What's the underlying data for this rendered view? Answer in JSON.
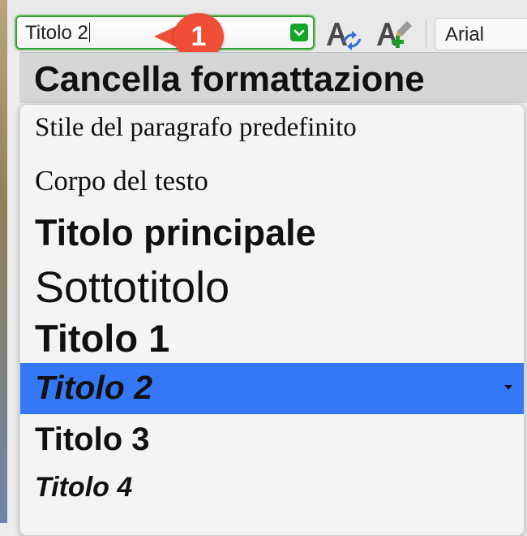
{
  "toolbar": {
    "paragraph_style_value": "Titolo 2",
    "font_name_value": "Arial",
    "combo_arrow_icon": "chevron-down-icon",
    "update_style_icon": "update-style-icon",
    "new_style_icon": "new-style-icon",
    "accent_green": "#34a233"
  },
  "callout": {
    "number": "1",
    "color": "#f04e36"
  },
  "dropdown": {
    "clear_formatting_label": "Cancella formattazione",
    "items": [
      {
        "label": "Stile del paragrafo predefinito",
        "selected": false
      },
      {
        "label": "Corpo del testo",
        "selected": false
      },
      {
        "label": "Titolo principale",
        "selected": false
      },
      {
        "label": "Sottotitolo",
        "selected": false
      },
      {
        "label": "Titolo 1",
        "selected": false
      },
      {
        "label": "Titolo 2",
        "selected": true
      },
      {
        "label": "Titolo 3",
        "selected": false
      },
      {
        "label": "Titolo 4",
        "selected": false
      }
    ],
    "selection_color": "#3478f6"
  }
}
